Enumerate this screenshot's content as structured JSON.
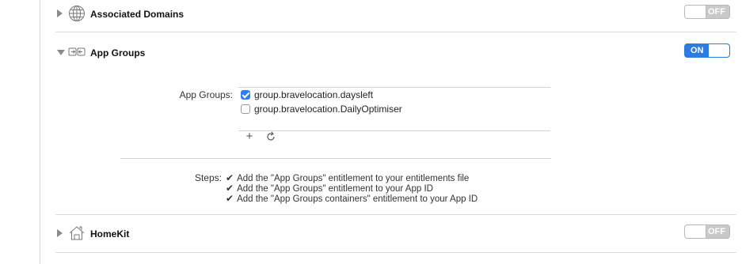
{
  "sections": {
    "associated_domains": {
      "title": "Associated Domains",
      "toggle": "OFF"
    },
    "app_groups": {
      "title": "App Groups",
      "toggle": "ON"
    },
    "homekit": {
      "title": "HomeKit",
      "toggle": "OFF"
    }
  },
  "app_groups_detail": {
    "label": "App Groups:",
    "items": [
      {
        "name": "group.bravelocation.daysleft",
        "checked": true
      },
      {
        "name": "group.bravelocation.DailyOptimiser",
        "checked": false
      }
    ],
    "add_button": "+",
    "refresh_icon": "refresh-icon"
  },
  "steps": {
    "label": "Steps:",
    "items": [
      "Add the \"App Groups\" entitlement to your entitlements file",
      "Add the \"App Groups\" entitlement to your App ID",
      "Add the \"App Groups containers\" entitlement to your App ID"
    ],
    "check_glyph": "✔"
  },
  "colors": {
    "accent": "#2d7ce0",
    "toggle_off": "#c9c9c9",
    "separator": "#dcdcdc"
  }
}
